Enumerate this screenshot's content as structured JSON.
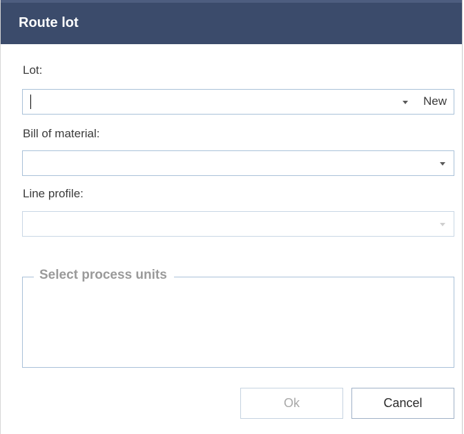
{
  "dialog": {
    "title": "Route lot"
  },
  "lot": {
    "label": "Lot:",
    "value": "",
    "new_label": "New"
  },
  "bom": {
    "label": "Bill of material:",
    "value": ""
  },
  "line_profile": {
    "label": "Line profile:",
    "value": ""
  },
  "process_units": {
    "legend": "Select process units"
  },
  "buttons": {
    "ok_label": "Ok",
    "cancel_label": "Cancel"
  },
  "colors": {
    "titlebar": "#3b4b6b",
    "field_border": "#a8c0d8",
    "disabled_text": "#a8a8a8"
  }
}
